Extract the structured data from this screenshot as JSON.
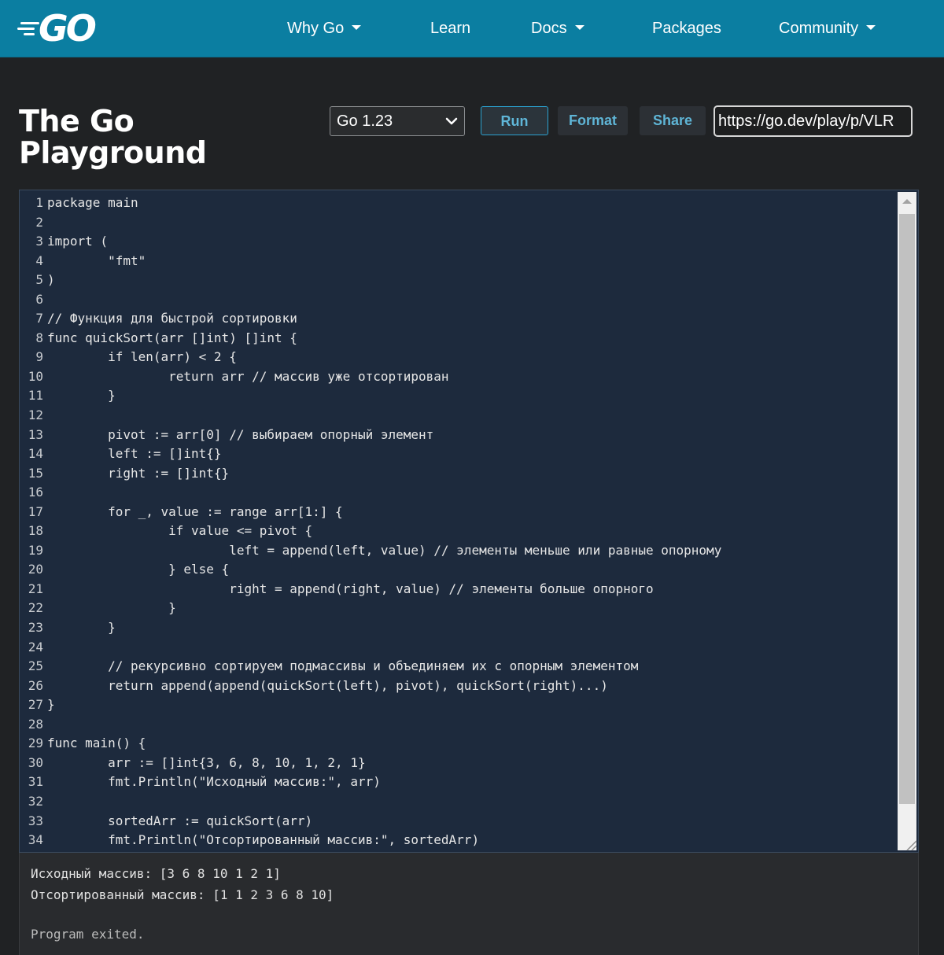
{
  "header": {
    "logo_text": "GO",
    "nav": [
      {
        "label": "Why Go",
        "dropdown": true
      },
      {
        "label": "Learn",
        "dropdown": false
      },
      {
        "label": "Docs",
        "dropdown": true
      },
      {
        "label": "Packages",
        "dropdown": false
      },
      {
        "label": "Community",
        "dropdown": true
      }
    ]
  },
  "playground": {
    "title_line1": "The Go",
    "title_line2": "Playground",
    "version": "Go 1.23",
    "run_label": "Run",
    "format_label": "Format",
    "share_label": "Share",
    "share_url": "https://go.dev/play/p/VLR"
  },
  "editor": {
    "lines": [
      "package main",
      "",
      "import (",
      "\t\"fmt\"",
      ")",
      "",
      "// Функция для быстрой сортировки",
      "func quickSort(arr []int) []int {",
      "\tif len(arr) < 2 {",
      "\t\treturn arr // массив уже отсортирован",
      "\t}",
      "",
      "\tpivot := arr[0] // выбираем опорный элемент",
      "\tleft := []int{}",
      "\tright := []int{}",
      "",
      "\tfor _, value := range arr[1:] {",
      "\t\tif value <= pivot {",
      "\t\t\tleft = append(left, value) // элементы меньше или равные опорному",
      "\t\t} else {",
      "\t\t\tright = append(right, value) // элементы больше опорного",
      "\t\t}",
      "\t}",
      "",
      "\t// рекурсивно сортируем подмассивы и объединяем их с опорным элементом",
      "\treturn append(append(quickSort(left), pivot), quickSort(right)...)",
      "}",
      "",
      "func main() {",
      "\tarr := []int{3, 6, 8, 10, 1, 2, 1}",
      "\tfmt.Println(\"Исходный массив:\", arr)",
      "",
      "\tsortedArr := quickSort(arr)",
      "\tfmt.Println(\"Отсортированный массив:\", sortedArr)"
    ]
  },
  "output": {
    "lines": [
      "Исходный массив: [3 6 8 10 1 2 1]",
      "Отсортированный массив: [1 1 2 3 6 8 10]"
    ],
    "exit_message": "Program exited."
  },
  "colors": {
    "header_bg": "#0b7ea1",
    "page_bg": "#202224",
    "editor_bg": "#1d2a3d",
    "output_bg": "#292b2e",
    "button_text": "#5fb5d6"
  },
  "icons": [
    "go-logo",
    "chevron-down-icon",
    "caret-down-icon",
    "scroll-up-arrow-icon",
    "resize-handle-icon"
  ]
}
